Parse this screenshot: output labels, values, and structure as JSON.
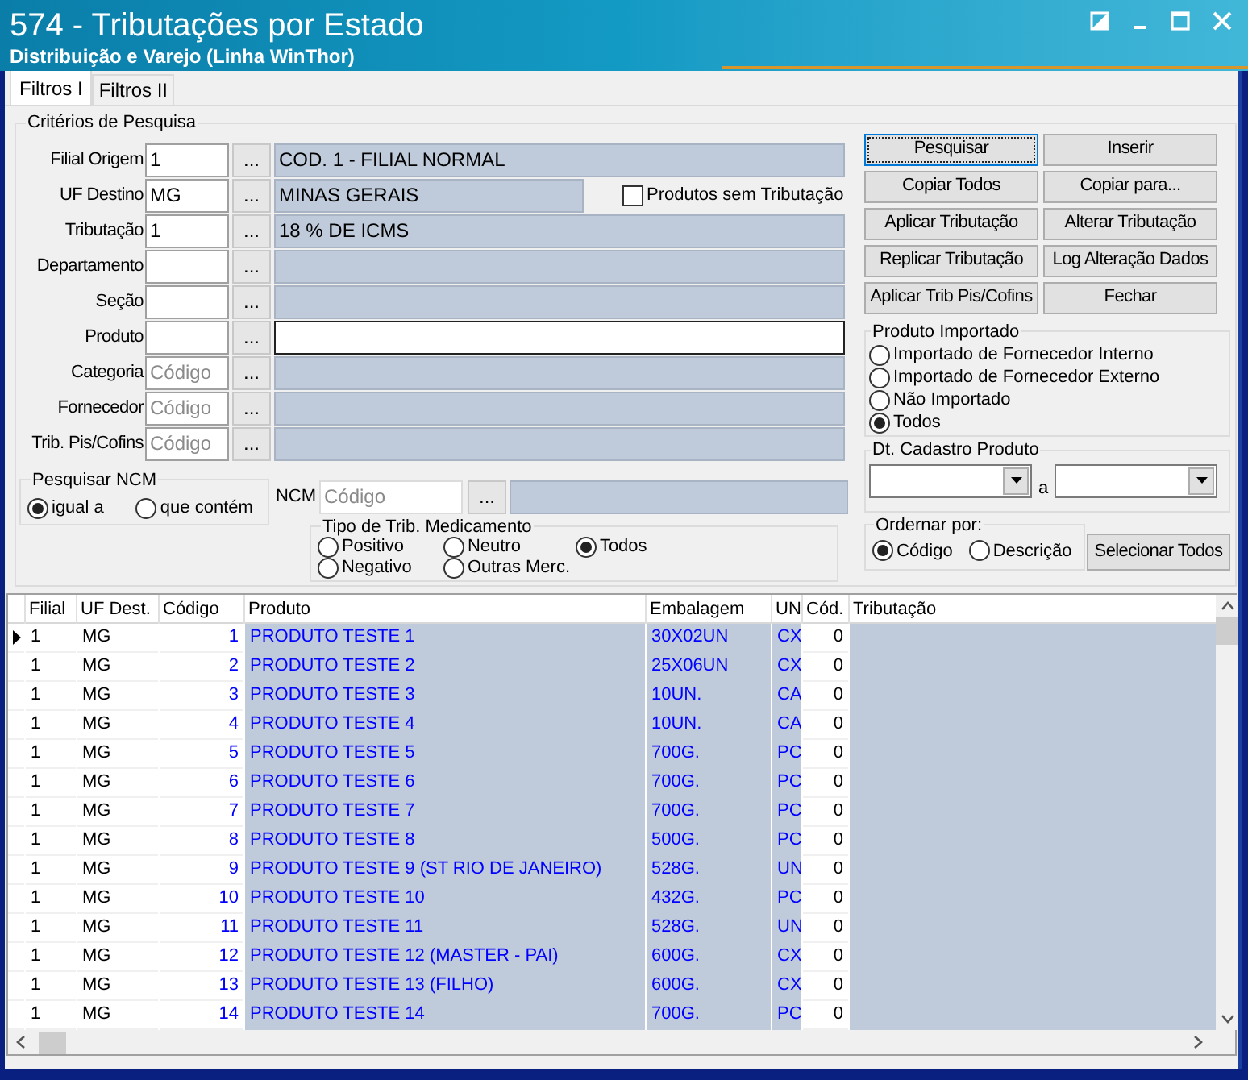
{
  "window": {
    "title": "574 - Tributações por Estado",
    "subtitle": "Distribuição e Varejo (Linha WinThor)"
  },
  "tabs": [
    {
      "label": "Filtros I",
      "selected": true
    },
    {
      "label": "Filtros II",
      "selected": false
    }
  ],
  "criteria": {
    "title": "Critérios de Pesquisa",
    "rows": [
      {
        "label": "Filial Origem",
        "code": "1",
        "button": "...",
        "description": "COD. 1 - FILIAL NORMAL",
        "editable": false
      },
      {
        "label": "UF Destino",
        "code": "MG",
        "button": "...",
        "description": "MINAS GERAIS",
        "editable": false
      },
      {
        "label": "Tributação",
        "code": "1",
        "button": "...",
        "description": "18 % DE ICMS",
        "editable": false
      },
      {
        "label": "Departamento",
        "button": "...",
        "editable": false
      },
      {
        "label": "Seção",
        "button": "...",
        "editable": false
      },
      {
        "label": "Produto",
        "button": "...",
        "editable": true
      },
      {
        "label": "Categoria",
        "placeholder": "Código",
        "button": "...",
        "editable": false
      },
      {
        "label": "Fornecedor",
        "placeholder": "Código",
        "button": "...",
        "editable": false
      },
      {
        "label": "Trib. Pis/Cofins",
        "placeholder": "Código",
        "button": "...",
        "editable": false
      }
    ]
  },
  "products_without_tax": {
    "label": "Produtos sem Tributação",
    "checked": false
  },
  "ncm_search": {
    "title": "Pesquisar NCM",
    "options": [
      {
        "label": "igual a",
        "selected": true
      },
      {
        "label": "que contém",
        "selected": false
      }
    ]
  },
  "ncm": {
    "label": "NCM",
    "placeholder": "Código",
    "button": "..."
  },
  "medication_type": {
    "title": "Tipo de Trib. Medicamento",
    "options": [
      {
        "label": "Positivo",
        "selected": false
      },
      {
        "label": "Neutro",
        "selected": false
      },
      {
        "label": "Todos",
        "selected": true
      },
      {
        "label": "Negativo",
        "selected": false
      },
      {
        "label": "Outras Merc.",
        "selected": false
      }
    ]
  },
  "buttons": [
    {
      "label": "Pesquisar",
      "focused": true
    },
    {
      "label": "Inserir",
      "focused": false
    },
    {
      "label": "Copiar Todos",
      "focused": false
    },
    {
      "label": "Copiar para...",
      "focused": false
    },
    {
      "label": "Aplicar Tributação",
      "focused": false
    },
    {
      "label": "Alterar Tributação",
      "focused": false
    },
    {
      "label": "Replicar Tributação",
      "focused": false
    },
    {
      "label": "Log Alteração Dados",
      "focused": false
    },
    {
      "label": "Aplicar Trib Pis/Cofins",
      "focused": false
    },
    {
      "label": "Fechar",
      "focused": false
    }
  ],
  "imported": {
    "title": "Produto Importado",
    "options": [
      {
        "label": "Importado de Fornecedor Interno",
        "selected": false
      },
      {
        "label": "Importado de Fornecedor Externo",
        "selected": false
      },
      {
        "label": "Não Importado",
        "selected": false
      },
      {
        "label": "Todos",
        "selected": true
      }
    ]
  },
  "date_range": {
    "title": "Dt. Cadastro Produto",
    "separator": "a"
  },
  "order_by": {
    "title": "Ordernar por:",
    "options": [
      {
        "label": "Código",
        "selected": true
      },
      {
        "label": "Descrição",
        "selected": false
      }
    ]
  },
  "select_all_button": "Selecionar Todos",
  "grid": {
    "columns": [
      "Filial",
      "UF Dest.",
      "Código",
      "Produto",
      "Embalagem",
      "UN",
      "Cód.",
      "Tributação"
    ],
    "rows": [
      {
        "filial": "1",
        "uf": "MG",
        "codigo": "1",
        "produto": "PRODUTO TESTE 1",
        "embalagem": "30X02UN",
        "un": "CX",
        "cod": "0",
        "current": true
      },
      {
        "filial": "1",
        "uf": "MG",
        "codigo": "2",
        "produto": "PRODUTO TESTE 2",
        "embalagem": "25X06UN",
        "un": "CX",
        "cod": "0",
        "current": false
      },
      {
        "filial": "1",
        "uf": "MG",
        "codigo": "3",
        "produto": "PRODUTO TESTE 3",
        "embalagem": "10UN.",
        "un": "CA",
        "cod": "0",
        "current": false
      },
      {
        "filial": "1",
        "uf": "MG",
        "codigo": "4",
        "produto": "PRODUTO TESTE 4",
        "embalagem": "10UN.",
        "un": "CA",
        "cod": "0",
        "current": false
      },
      {
        "filial": "1",
        "uf": "MG",
        "codigo": "5",
        "produto": "PRODUTO TESTE 5",
        "embalagem": "700G.",
        "un": "PC",
        "cod": "0",
        "current": false
      },
      {
        "filial": "1",
        "uf": "MG",
        "codigo": "6",
        "produto": "PRODUTO TESTE 6",
        "embalagem": "700G.",
        "un": "PC",
        "cod": "0",
        "current": false
      },
      {
        "filial": "1",
        "uf": "MG",
        "codigo": "7",
        "produto": "PRODUTO TESTE 7",
        "embalagem": "700G.",
        "un": "PC",
        "cod": "0",
        "current": false
      },
      {
        "filial": "1",
        "uf": "MG",
        "codigo": "8",
        "produto": "PRODUTO TESTE 8",
        "embalagem": "500G.",
        "un": "PC",
        "cod": "0",
        "current": false
      },
      {
        "filial": "1",
        "uf": "MG",
        "codigo": "9",
        "produto": "PRODUTO TESTE 9 (ST RIO DE JANEIRO)",
        "embalagem": "528G.",
        "un": "UN",
        "cod": "0",
        "current": false
      },
      {
        "filial": "1",
        "uf": "MG",
        "codigo": "10",
        "produto": "PRODUTO TESTE 10",
        "embalagem": "432G.",
        "un": "PC",
        "cod": "0",
        "current": false
      },
      {
        "filial": "1",
        "uf": "MG",
        "codigo": "11",
        "produto": "PRODUTO TESTE 11",
        "embalagem": "528G.",
        "un": "UN",
        "cod": "0",
        "current": false
      },
      {
        "filial": "1",
        "uf": "MG",
        "codigo": "12",
        "produto": "PRODUTO TESTE 12 (MASTER - PAI)",
        "embalagem": "600G.",
        "un": "CX",
        "cod": "0",
        "current": false
      },
      {
        "filial": "1",
        "uf": "MG",
        "codigo": "13",
        "produto": "PRODUTO TESTE 13 (FILHO)",
        "embalagem": "600G.",
        "un": "CX",
        "cod": "0",
        "current": false
      },
      {
        "filial": "1",
        "uf": "MG",
        "codigo": "14",
        "produto": "PRODUTO TESTE 14",
        "embalagem": "700G.",
        "un": "PC",
        "cod": "0",
        "current": false
      }
    ]
  }
}
